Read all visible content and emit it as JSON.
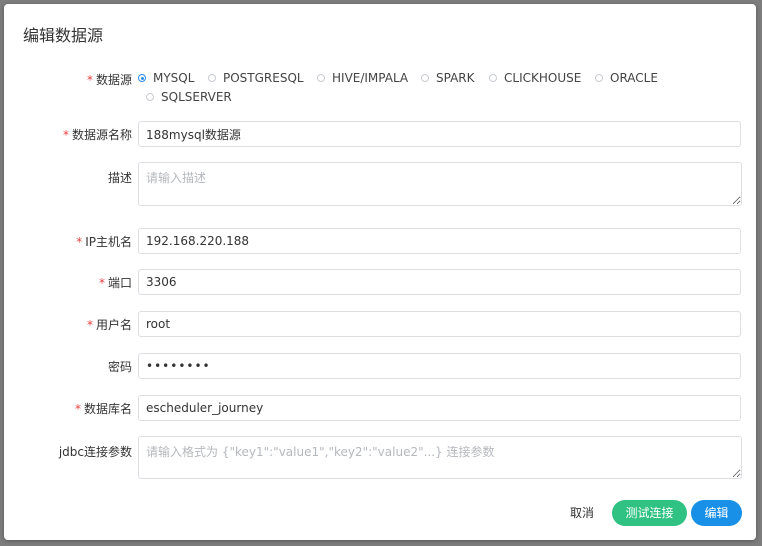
{
  "dialog": {
    "title": "编辑数据源"
  },
  "datasource": {
    "label": "数据源",
    "options": [
      "MYSQL",
      "POSTGRESQL",
      "HIVE/IMPALA",
      "SPARK",
      "CLICKHOUSE",
      "ORACLE",
      "SQLSERVER"
    ],
    "selected": "MYSQL"
  },
  "fields": {
    "name": {
      "label": "数据源名称",
      "value": "188mysql数据源"
    },
    "description": {
      "label": "描述",
      "placeholder": "请输入描述"
    },
    "host": {
      "label": "IP主机名",
      "value": "192.168.220.188"
    },
    "port": {
      "label": "端口",
      "value": "3306"
    },
    "username": {
      "label": "用户名",
      "value": "root"
    },
    "password": {
      "label": "密码",
      "value": "••••••••"
    },
    "database": {
      "label": "数据库名",
      "value": "escheduler_journey"
    },
    "jdbc": {
      "label": "jdbc连接参数",
      "placeholder": "请输入格式为 {\"key1\":\"value1\",\"key2\":\"value2\"...} 连接参数"
    }
  },
  "required_mark": "*",
  "buttons": {
    "cancel": "取消",
    "test": "测试连接",
    "edit": "编辑"
  },
  "colors": {
    "required": "#e64242",
    "radio_selected": "#2d8cf0",
    "test_button": "#2fc283",
    "edit_button": "#1890e8"
  }
}
